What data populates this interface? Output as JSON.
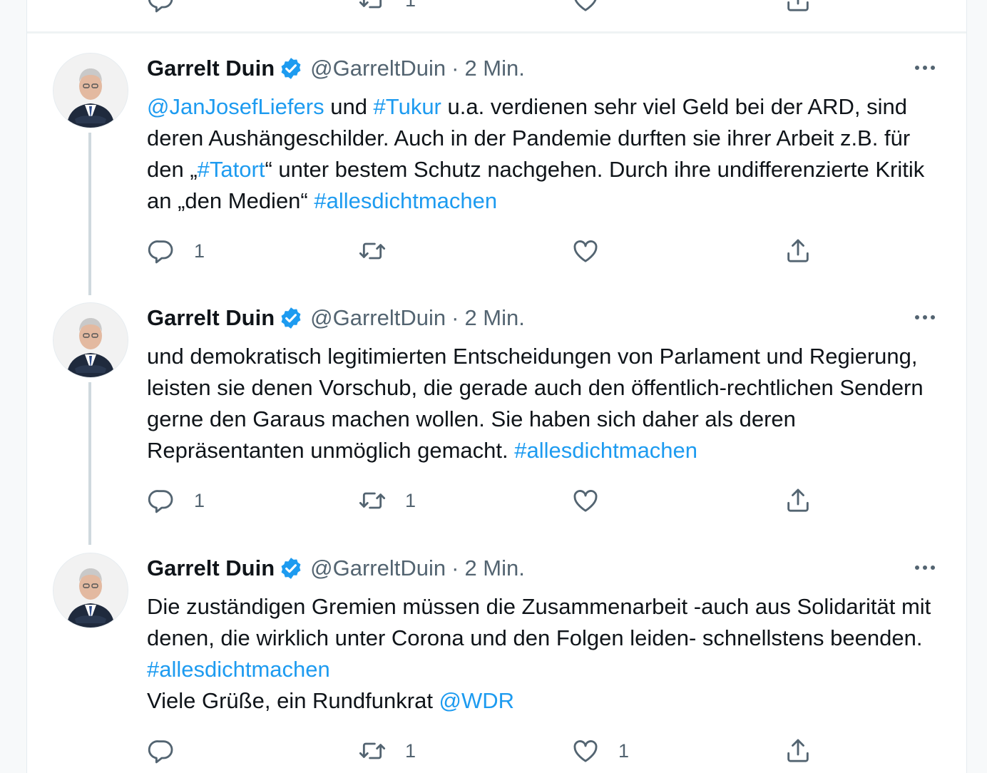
{
  "tweets": [
    {
      "name": "Garrelt Duin",
      "handle": "@GarreltDuin",
      "sep": "·",
      "time": "2 Min.",
      "segments": [
        {
          "t": "@JanJosefLiefers",
          "link": true
        },
        {
          "t": " und "
        },
        {
          "t": "#Tukur",
          "link": true
        },
        {
          "t": " u.a. verdienen sehr viel Geld bei der ARD, sind deren Aushängeschilder. Auch in der Pandemie durften sie ihrer Arbeit z.B. für den „"
        },
        {
          "t": "#Tatort",
          "link": true
        },
        {
          "t": "“ unter bestem Schutz nachgehen. Durch ihre undifferenzierte Kritik an „den Medien“ "
        },
        {
          "t": "#allesdichtmachen",
          "link": true
        }
      ],
      "replies": "1",
      "retweets": "",
      "likes": ""
    },
    {
      "name": "Garrelt Duin",
      "handle": "@GarreltDuin",
      "sep": "·",
      "time": "2 Min.",
      "segments": [
        {
          "t": "und demokratisch legitimierten Entscheidungen von Parlament und Regierung, leisten sie denen Vorschub, die gerade auch den öffentlich-rechtlichen Sendern gerne den Garaus machen wollen. Sie haben sich daher als deren Repräsentanten unmöglich gemacht. "
        },
        {
          "t": "#allesdichtmachen",
          "link": true
        }
      ],
      "replies": "1",
      "retweets": "1",
      "likes": ""
    },
    {
      "name": "Garrelt Duin",
      "handle": "@GarreltDuin",
      "sep": "·",
      "time": "2 Min.",
      "segments": [
        {
          "t": "Die zuständigen Gremien müssen die Zusammenarbeit -auch aus Solidarität mit denen, die wirklich unter Corona und den Folgen leiden- schnellstens beenden. "
        },
        {
          "t": "#allesdichtmachen",
          "link": true
        },
        {
          "t": "\nViele Grüße, ein Rundfunkrat "
        },
        {
          "t": "@WDR",
          "link": true
        }
      ],
      "replies": "",
      "retweets": "1",
      "likes": "1"
    }
  ],
  "previous_tweet": {
    "retweets": "1"
  },
  "colors": {
    "link": "#1d9bf0",
    "muted": "#536471",
    "verified": "#1d9bf0"
  }
}
